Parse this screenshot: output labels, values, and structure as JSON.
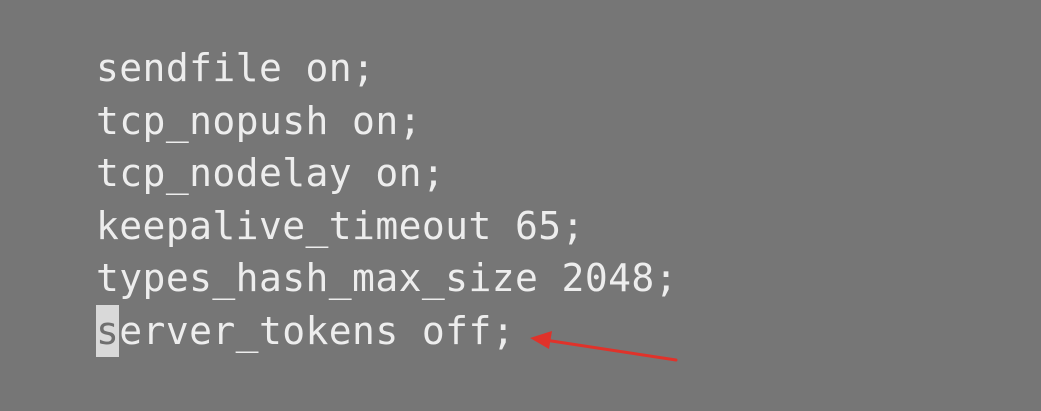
{
  "config_lines": [
    {
      "text": "sendfile on;"
    },
    {
      "text": "tcp_nopush on;"
    },
    {
      "text": "tcp_nodelay on;"
    },
    {
      "text": "keepalive_timeout 65;"
    },
    {
      "text": "types_hash_max_size 2048;"
    }
  ],
  "cursor_line": {
    "cursor_char": "s",
    "rest": "erver_tokens off;"
  },
  "annotation": {
    "type": "arrow",
    "color": "#e0322a",
    "points_to": "server_tokens off;"
  },
  "colors": {
    "background": "#767676",
    "text": "#ededed",
    "cursor": "#d9d9d9"
  }
}
